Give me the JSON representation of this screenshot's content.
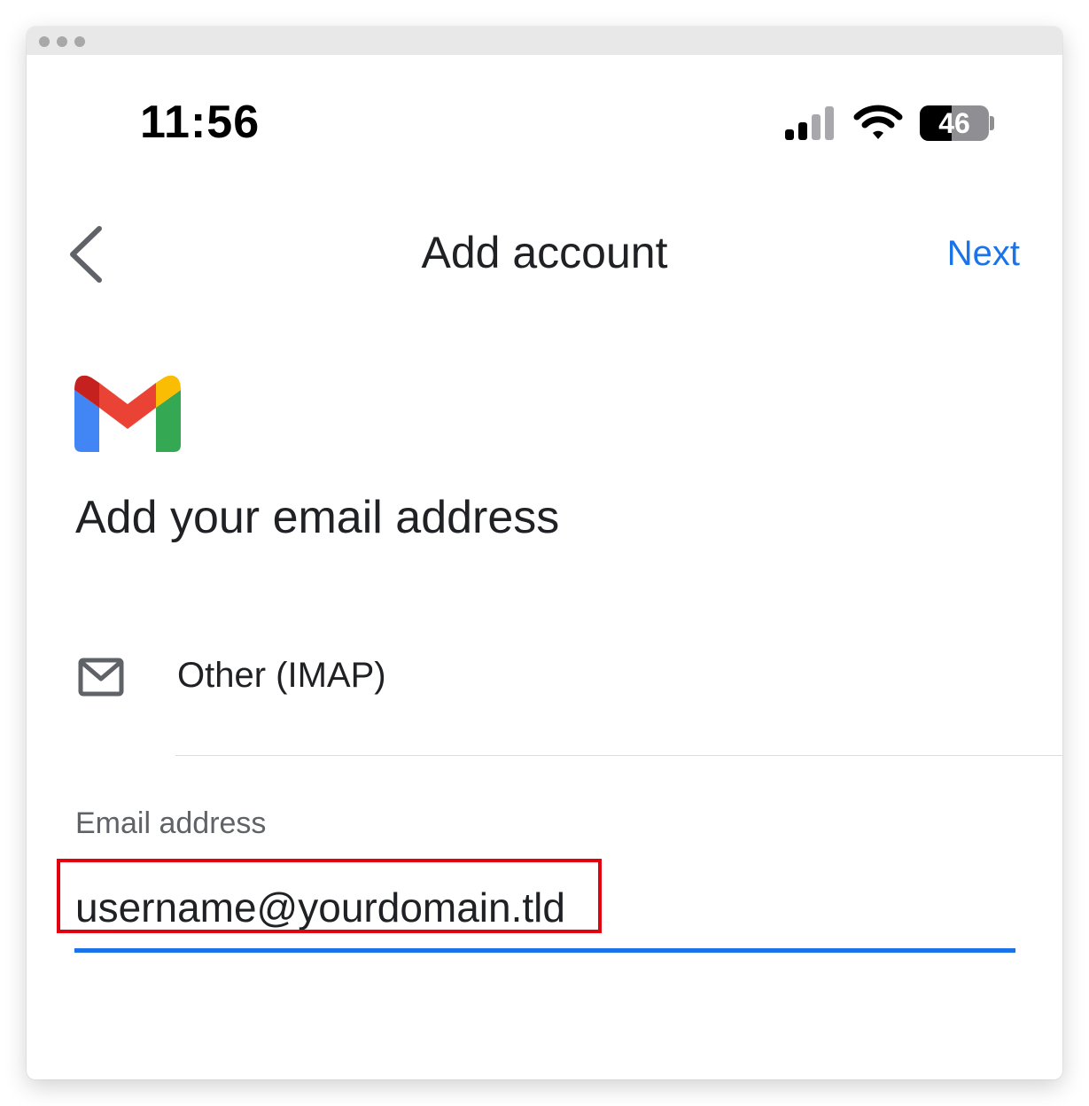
{
  "status_bar": {
    "time": "11:56",
    "battery_percent": "46",
    "battery_level": 0.46,
    "signal_icon": "cellular-signal-icon",
    "wifi_icon": "wifi-icon"
  },
  "header": {
    "title": "Add account",
    "next_label": "Next",
    "back_icon": "chevron-left-icon"
  },
  "logo": "gmail-logo",
  "heading": "Add your email address",
  "account_option": {
    "label": "Other (IMAP)",
    "icon": "mail-icon"
  },
  "email_field": {
    "label": "Email address",
    "value": "username@yourdomain.tld"
  },
  "colors": {
    "accent": "#1a73e8",
    "highlight": "#e3000f",
    "gmail_red": "#ea4335",
    "gmail_blue": "#4285f4",
    "gmail_green": "#34a853",
    "gmail_yellow": "#fbbc04"
  }
}
